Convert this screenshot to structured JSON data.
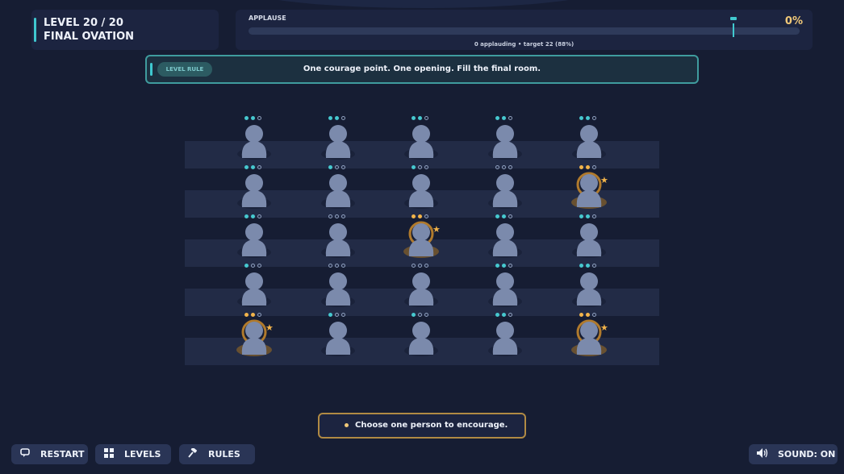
{
  "level": {
    "line1": "LEVEL 20  /  20",
    "line2": "FINAL OVATION"
  },
  "applause": {
    "label": "APPLAUSE",
    "percent_text": "0%",
    "status": "0 applauding  •  target 22 (88%)",
    "fill_fraction": 0,
    "target_fraction": 0.88
  },
  "rule": {
    "tag": "LEVEL RULE",
    "text": "One courage point. One opening. Fill the final room."
  },
  "crowd": {
    "rows": [
      [
        {
          "dots": [
            1,
            1,
            0
          ],
          "star": false
        },
        {
          "dots": [
            1,
            1,
            0
          ],
          "star": false
        },
        {
          "dots": [
            1,
            1,
            0
          ],
          "star": false
        },
        {
          "dots": [
            1,
            1,
            0
          ],
          "star": false
        },
        {
          "dots": [
            1,
            1,
            0
          ],
          "star": false
        }
      ],
      [
        {
          "dots": [
            1,
            1,
            0
          ],
          "star": false
        },
        {
          "dots": [
            1,
            0,
            0
          ],
          "star": false
        },
        {
          "dots": [
            1,
            0,
            0
          ],
          "star": false
        },
        {
          "dots": [
            0,
            0,
            0
          ],
          "star": false
        },
        {
          "dots": [
            2,
            2,
            0
          ],
          "star": true
        }
      ],
      [
        {
          "dots": [
            1,
            1,
            0
          ],
          "star": false
        },
        {
          "dots": [
            0,
            0,
            0
          ],
          "star": false
        },
        {
          "dots": [
            2,
            2,
            0
          ],
          "star": true
        },
        {
          "dots": [
            1,
            1,
            0
          ],
          "star": false
        },
        {
          "dots": [
            1,
            1,
            0
          ],
          "star": false
        }
      ],
      [
        {
          "dots": [
            1,
            0,
            0
          ],
          "star": false
        },
        {
          "dots": [
            0,
            0,
            0
          ],
          "star": false
        },
        {
          "dots": [
            0,
            0,
            0
          ],
          "star": false
        },
        {
          "dots": [
            1,
            1,
            0
          ],
          "star": false
        },
        {
          "dots": [
            1,
            1,
            0
          ],
          "star": false
        }
      ],
      [
        {
          "dots": [
            2,
            2,
            0
          ],
          "star": true
        },
        {
          "dots": [
            1,
            0,
            0
          ],
          "star": false
        },
        {
          "dots": [
            1,
            0,
            0
          ],
          "star": false
        },
        {
          "dots": [
            1,
            1,
            0
          ],
          "star": false
        },
        {
          "dots": [
            2,
            2,
            0
          ],
          "star": true
        }
      ]
    ]
  },
  "prompt": {
    "text": "Choose one person to encourage."
  },
  "buttons": {
    "restart": "RESTART",
    "levels": "LEVELS",
    "rules": "RULES",
    "sound": "SOUND: ON"
  },
  "icons": {
    "restart": "restart-icon",
    "levels": "grid-icon",
    "rules": "gavel-icon",
    "sound": "speaker-icon",
    "star": "star-icon"
  },
  "colors": {
    "background": "#161d33",
    "panel": "#1c2440",
    "accent_teal": "#3fc7cf",
    "gold": "#f2b44a",
    "person": "#7b8aac"
  }
}
